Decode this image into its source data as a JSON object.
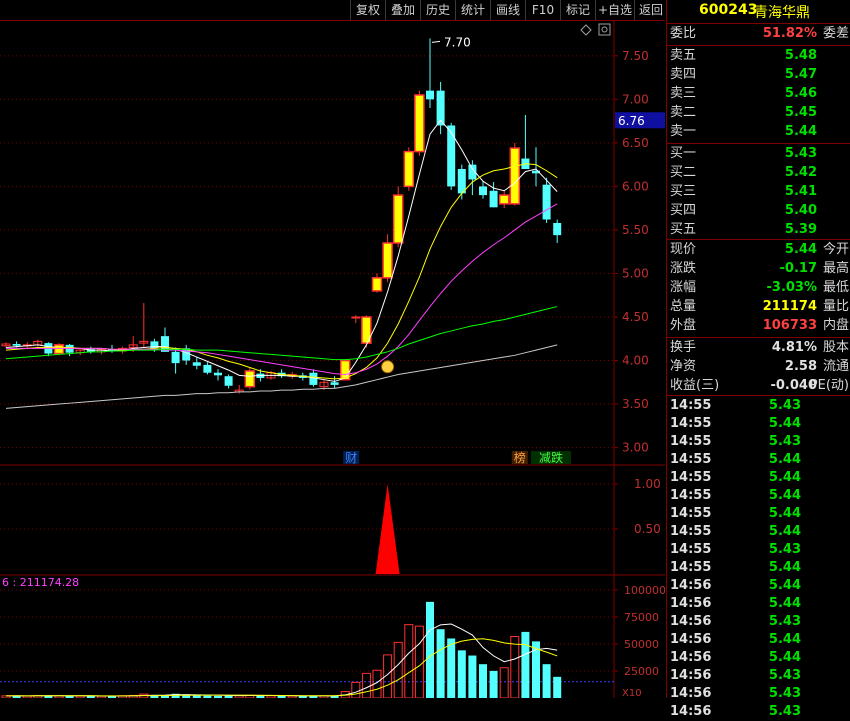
{
  "toolbar": {
    "buttons": [
      "复权",
      "叠加",
      "历史",
      "统计",
      "画线",
      "F10",
      "标记",
      "+自选",
      "返回"
    ]
  },
  "header": {
    "code": "600243",
    "name": "青海华鼎"
  },
  "quote": {
    "weibi_label": "委比",
    "weibi_value": "51.82%",
    "weibi_suffix": "委差",
    "asks": [
      {
        "label": "卖五",
        "price": "5.48"
      },
      {
        "label": "卖四",
        "price": "5.47"
      },
      {
        "label": "卖三",
        "price": "5.46"
      },
      {
        "label": "卖二",
        "price": "5.45"
      },
      {
        "label": "卖一",
        "price": "5.44"
      }
    ],
    "bids": [
      {
        "label": "买一",
        "price": "5.43"
      },
      {
        "label": "买二",
        "price": "5.42"
      },
      {
        "label": "买三",
        "price": "5.41"
      },
      {
        "label": "买四",
        "price": "5.40"
      },
      {
        "label": "买五",
        "price": "5.39"
      }
    ],
    "stats1": [
      {
        "label": "现价",
        "value": "5.44",
        "suffix": "今开",
        "color": "#00e000"
      },
      {
        "label": "涨跌",
        "value": "-0.17",
        "suffix": "最高",
        "color": "#00e000"
      },
      {
        "label": "涨幅",
        "value": "-3.03%",
        "suffix": "最低",
        "color": "#00e000"
      },
      {
        "label": "总量",
        "value": "211174",
        "suffix": "量比",
        "color": "#ffff00"
      },
      {
        "label": "外盘",
        "value": "106733",
        "suffix": "内盘",
        "color": "#ff4040"
      }
    ],
    "stats2": [
      {
        "label": "换手",
        "value": "4.81%",
        "suffix": "股本",
        "color": "#e0e0e0"
      },
      {
        "label": "净资",
        "value": "2.58",
        "suffix": "流通",
        "color": "#e0e0e0"
      },
      {
        "label": "收益(三)",
        "value": "-0.040",
        "suffix": "PE(动)",
        "color": "#e0e0e0"
      }
    ]
  },
  "ticks": [
    {
      "time": "14:55",
      "price": "5.43"
    },
    {
      "time": "14:55",
      "price": "5.44"
    },
    {
      "time": "14:55",
      "price": "5.43"
    },
    {
      "time": "14:55",
      "price": "5.44"
    },
    {
      "time": "14:55",
      "price": "5.44"
    },
    {
      "time": "14:55",
      "price": "5.44"
    },
    {
      "time": "14:55",
      "price": "5.44"
    },
    {
      "time": "14:55",
      "price": "5.44"
    },
    {
      "time": "14:55",
      "price": "5.43"
    },
    {
      "time": "14:55",
      "price": "5.44"
    },
    {
      "time": "14:56",
      "price": "5.44"
    },
    {
      "time": "14:56",
      "price": "5.44"
    },
    {
      "time": "14:56",
      "price": "5.43"
    },
    {
      "time": "14:56",
      "price": "5.44"
    },
    {
      "time": "14:56",
      "price": "5.44"
    },
    {
      "time": "14:56",
      "price": "5.43"
    },
    {
      "time": "14:56",
      "price": "5.43"
    },
    {
      "time": "14:56",
      "price": "5.43"
    }
  ],
  "chart_data": {
    "type": "candlestick",
    "price_axis": {
      "ticks": [
        "7.50",
        "7.00",
        "6.50",
        "6.00",
        "5.50",
        "5.00",
        "4.50",
        "4.00",
        "3.50",
        "3.00"
      ],
      "ylim": [
        2.8,
        7.9
      ]
    },
    "current_price_tag": "6.76",
    "high_annotation": "7.70",
    "markers": [
      {
        "text": "财",
        "color": "#4080ff"
      },
      {
        "text": "榜",
        "color": "#ffa040"
      },
      {
        "text": "减跌",
        "color": "#40ff40"
      }
    ],
    "candles": [
      [
        4.17,
        4.21,
        4.15,
        4.19
      ],
      [
        4.19,
        4.22,
        4.15,
        4.17
      ],
      [
        4.17,
        4.21,
        4.13,
        4.18
      ],
      [
        4.18,
        4.24,
        4.16,
        4.22
      ],
      [
        4.2,
        4.21,
        4.05,
        4.08
      ],
      [
        4.08,
        4.2,
        4.06,
        4.18
      ],
      [
        4.18,
        4.19,
        4.05,
        4.09
      ],
      [
        4.09,
        4.14,
        4.06,
        4.12
      ],
      [
        4.13,
        4.16,
        4.08,
        4.1
      ],
      [
        4.1,
        4.14,
        4.07,
        4.13
      ],
      [
        4.13,
        4.18,
        4.09,
        4.11
      ],
      [
        4.11,
        4.16,
        4.08,
        4.14
      ],
      [
        4.15,
        4.28,
        4.1,
        4.18
      ],
      [
        4.2,
        4.66,
        4.15,
        4.22
      ],
      [
        4.22,
        4.25,
        4.1,
        4.14
      ],
      [
        4.28,
        4.38,
        4.1,
        4.1
      ],
      [
        4.1,
        4.15,
        3.85,
        3.97
      ],
      [
        4.14,
        4.18,
        3.95,
        4.0
      ],
      [
        3.98,
        4.04,
        3.9,
        3.94
      ],
      [
        3.95,
        3.98,
        3.84,
        3.86
      ],
      [
        3.86,
        3.9,
        3.77,
        3.83
      ],
      [
        3.82,
        3.84,
        3.68,
        3.71
      ],
      [
        3.64,
        3.72,
        3.62,
        3.66
      ],
      [
        3.7,
        3.92,
        3.67,
        3.88
      ],
      [
        3.85,
        3.9,
        3.76,
        3.8
      ],
      [
        3.8,
        3.88,
        3.78,
        3.86
      ],
      [
        3.86,
        3.9,
        3.8,
        3.82
      ],
      [
        3.82,
        3.87,
        3.79,
        3.84
      ],
      [
        3.83,
        3.86,
        3.77,
        3.8
      ],
      [
        3.86,
        3.9,
        3.7,
        3.72
      ],
      [
        3.7,
        3.78,
        3.66,
        3.75
      ],
      [
        3.75,
        3.82,
        3.68,
        3.72
      ],
      [
        3.78,
        4.0,
        3.78,
        4.0
      ],
      [
        4.5,
        4.52,
        4.43,
        4.5
      ],
      [
        4.2,
        4.52,
        4.15,
        4.5
      ],
      [
        4.8,
        5.0,
        4.78,
        4.95
      ],
      [
        4.95,
        5.45,
        4.9,
        5.35
      ],
      [
        5.35,
        6.0,
        5.3,
        5.9
      ],
      [
        6.0,
        6.45,
        5.95,
        6.4
      ],
      [
        6.4,
        7.1,
        6.35,
        7.05
      ],
      [
        7.1,
        7.7,
        6.9,
        7.0
      ],
      [
        7.1,
        7.2,
        6.6,
        6.7
      ],
      [
        6.7,
        6.73,
        5.96,
        6.0
      ],
      [
        6.2,
        6.25,
        5.85,
        5.92
      ],
      [
        6.25,
        6.3,
        5.9,
        6.08
      ],
      [
        6.0,
        6.06,
        5.86,
        5.9
      ],
      [
        5.95,
        6.05,
        5.76,
        5.76
      ],
      [
        5.8,
        5.95,
        5.75,
        5.9
      ],
      [
        5.8,
        6.5,
        5.78,
        6.44
      ],
      [
        6.32,
        6.82,
        6.2,
        6.2
      ],
      [
        6.18,
        6.45,
        6.0,
        6.15
      ],
      [
        6.02,
        6.1,
        5.58,
        5.62
      ],
      [
        5.58,
        5.62,
        5.35,
        5.44
      ]
    ],
    "ma_series": [
      {
        "color": "#ffffff",
        "values": [
          4.15,
          4.16,
          4.17,
          4.18,
          4.16,
          4.15,
          4.14,
          4.14,
          4.12,
          4.12,
          4.11,
          4.12,
          4.14,
          4.15,
          4.16,
          4.16,
          4.13,
          4.09,
          4.04,
          3.99,
          3.94,
          3.89,
          3.83,
          3.82,
          3.83,
          3.83,
          3.83,
          3.82,
          3.82,
          3.8,
          3.78,
          3.76,
          3.8,
          3.98,
          4.18,
          4.43,
          4.79,
          5.2,
          5.66,
          6.14,
          6.6,
          6.76,
          6.62,
          6.42,
          6.2,
          6.06,
          5.98,
          5.95,
          6.04,
          6.17,
          6.2,
          6.07,
          5.94
        ]
      },
      {
        "color": "#ffff00",
        "values": [
          4.12,
          4.13,
          4.14,
          4.15,
          4.15,
          4.15,
          4.15,
          4.14,
          4.14,
          4.14,
          4.13,
          4.12,
          4.12,
          4.13,
          4.14,
          4.15,
          4.14,
          4.13,
          4.1,
          4.06,
          4.03,
          3.99,
          3.96,
          3.92,
          3.88,
          3.86,
          3.84,
          3.83,
          3.82,
          3.81,
          3.8,
          3.79,
          3.8,
          3.85,
          3.92,
          4.03,
          4.2,
          4.42,
          4.68,
          4.96,
          5.28,
          5.54,
          5.76,
          5.92,
          6.05,
          6.13,
          6.18,
          6.2,
          6.23,
          6.26,
          6.25,
          6.18,
          6.1
        ]
      },
      {
        "color": "#ff40ff",
        "values": [
          4.14,
          4.14,
          4.14,
          4.14,
          4.14,
          4.14,
          4.14,
          4.14,
          4.14,
          4.14,
          4.13,
          4.13,
          4.13,
          4.13,
          4.13,
          4.12,
          4.12,
          4.11,
          4.1,
          4.09,
          4.07,
          4.05,
          4.03,
          4.01,
          3.99,
          3.97,
          3.95,
          3.93,
          3.91,
          3.89,
          3.87,
          3.85,
          3.84,
          3.86,
          3.9,
          3.96,
          4.05,
          4.16,
          4.3,
          4.46,
          4.62,
          4.77,
          4.91,
          5.03,
          5.14,
          5.24,
          5.33,
          5.41,
          5.5,
          5.59,
          5.66,
          5.73,
          5.8
        ]
      },
      {
        "color": "#00ff00",
        "values": [
          4.02,
          4.03,
          4.04,
          4.05,
          4.06,
          4.07,
          4.08,
          4.09,
          4.1,
          4.1,
          4.11,
          4.11,
          4.12,
          4.12,
          4.12,
          4.13,
          4.13,
          4.13,
          4.12,
          4.12,
          4.12,
          4.11,
          4.1,
          4.09,
          4.08,
          4.07,
          4.06,
          4.05,
          4.04,
          4.03,
          4.02,
          4.01,
          4.01,
          4.02,
          4.04,
          4.07,
          4.1,
          4.14,
          4.19,
          4.23,
          4.27,
          4.31,
          4.34,
          4.37,
          4.4,
          4.42,
          4.45,
          4.47,
          4.5,
          4.53,
          4.56,
          4.59,
          4.62
        ]
      },
      {
        "color": "#c8c8c8",
        "values": [
          3.45,
          3.46,
          3.47,
          3.48,
          3.49,
          3.5,
          3.51,
          3.52,
          3.53,
          3.54,
          3.55,
          3.56,
          3.57,
          3.58,
          3.59,
          3.6,
          3.6,
          3.61,
          3.62,
          3.62,
          3.63,
          3.63,
          3.64,
          3.64,
          3.65,
          3.65,
          3.66,
          3.66,
          3.67,
          3.67,
          3.68,
          3.68,
          3.7,
          3.72,
          3.75,
          3.78,
          3.81,
          3.84,
          3.86,
          3.88,
          3.9,
          3.92,
          3.94,
          3.96,
          3.98,
          4.0,
          4.02,
          4.04,
          4.06,
          4.09,
          4.12,
          4.15,
          4.18
        ]
      }
    ],
    "signal_panel": {
      "ticks": [
        "1.00",
        "0.50"
      ],
      "ylim": [
        0,
        1.2
      ],
      "signal_index": 36
    },
    "volume_panel": {
      "header": "6 : 211174.28",
      "ticks": [
        "100000",
        "75000",
        "50000",
        "25000"
      ],
      "ylim": [
        0,
        112000
      ],
      "unit": "X10",
      "values": [
        2000,
        2100,
        1800,
        2200,
        2500,
        2000,
        1900,
        1800,
        2000,
        1700,
        1900,
        2100,
        2400,
        3600,
        2600,
        2500,
        3900,
        3000,
        2300,
        2200,
        2000,
        2400,
        2100,
        2600,
        2300,
        2000,
        2100,
        1800,
        1900,
        2200,
        2000,
        2100,
        6000,
        14500,
        22800,
        25700,
        39900,
        51500,
        67900,
        66500,
        89000,
        63700,
        55100,
        44100,
        39300,
        31300,
        25100,
        28000,
        56900,
        61200,
        52400,
        31300,
        19600
      ]
    }
  }
}
